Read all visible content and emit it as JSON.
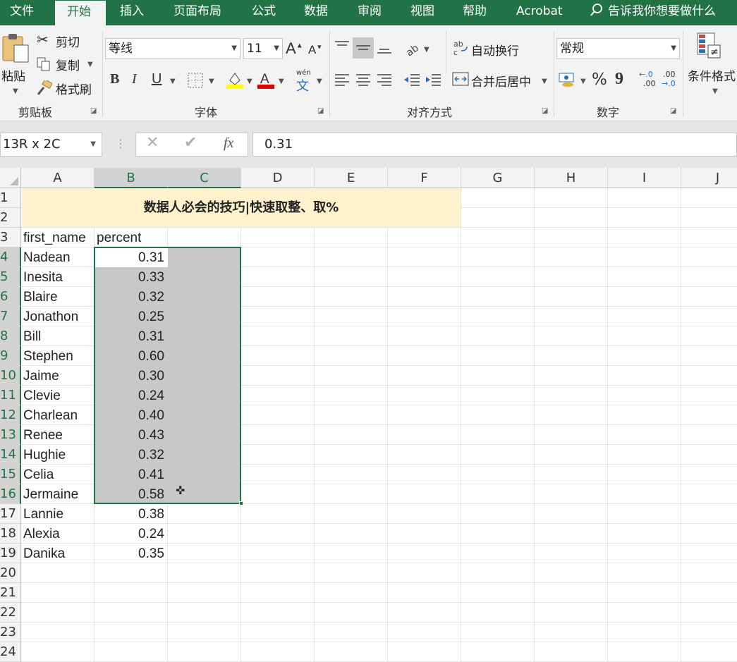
{
  "tabs": [
    "文件",
    "开始",
    "插入",
    "页面布局",
    "公式",
    "数据",
    "审阅",
    "视图",
    "帮助",
    "Acrobat"
  ],
  "active_tab": "开始",
  "tell_me": "告诉我你想要做什么",
  "clipboard": {
    "paste": "粘贴",
    "cut": "剪切",
    "copy": "复制",
    "format_painter": "格式刷",
    "label": "剪贴板"
  },
  "font": {
    "name": "等线",
    "size": "11",
    "label": "字体",
    "bold": "B",
    "italic": "I",
    "underline": "U",
    "wen": "wén",
    "wen_char": "文"
  },
  "alignment": {
    "wrap": "自动换行",
    "merge": "合并后居中",
    "label": "对齐方式"
  },
  "number": {
    "format": "常规",
    "percent": "%",
    "comma": "9",
    "label": "数字",
    "inc_dec": ".00"
  },
  "styles": {
    "conditional": "条件格式"
  },
  "formula_bar": {
    "name_box": "13R x 2C",
    "value": "0.31",
    "fx": "fx"
  },
  "columns": [
    "A",
    "B",
    "C",
    "D",
    "E",
    "F",
    "G",
    "H",
    "I",
    "J"
  ],
  "rows": [
    "1",
    "2",
    "3",
    "4",
    "5",
    "6",
    "7",
    "8",
    "9",
    "10",
    "11",
    "12",
    "13",
    "14",
    "15",
    "16",
    "17",
    "18",
    "19",
    "20",
    "21",
    "22",
    "23",
    "24"
  ],
  "sheet": {
    "title": "数据人必会的技巧|快速取整、取%",
    "headers": [
      "first_name",
      "percent"
    ],
    "data": [
      [
        "Nadean",
        "0.31"
      ],
      [
        "Inesita",
        "0.33"
      ],
      [
        "Blaire",
        "0.32"
      ],
      [
        "Jonathon",
        "0.25"
      ],
      [
        "Bill",
        "0.31"
      ],
      [
        "Stephen",
        "0.60"
      ],
      [
        "Jaime",
        "0.30"
      ],
      [
        "Clevie",
        "0.24"
      ],
      [
        "Charlean",
        "0.40"
      ],
      [
        "Renee",
        "0.43"
      ],
      [
        "Hughie",
        "0.32"
      ],
      [
        "Celia",
        "0.41"
      ],
      [
        "Jermaine",
        "0.58"
      ],
      [
        "Lannie",
        "0.38"
      ],
      [
        "Alexia",
        "0.24"
      ],
      [
        "Danika",
        "0.35"
      ]
    ]
  },
  "colors": {
    "accent": "#217346",
    "title_fill": "#fff2cc",
    "selection_fill": "#c8c8c8"
  }
}
